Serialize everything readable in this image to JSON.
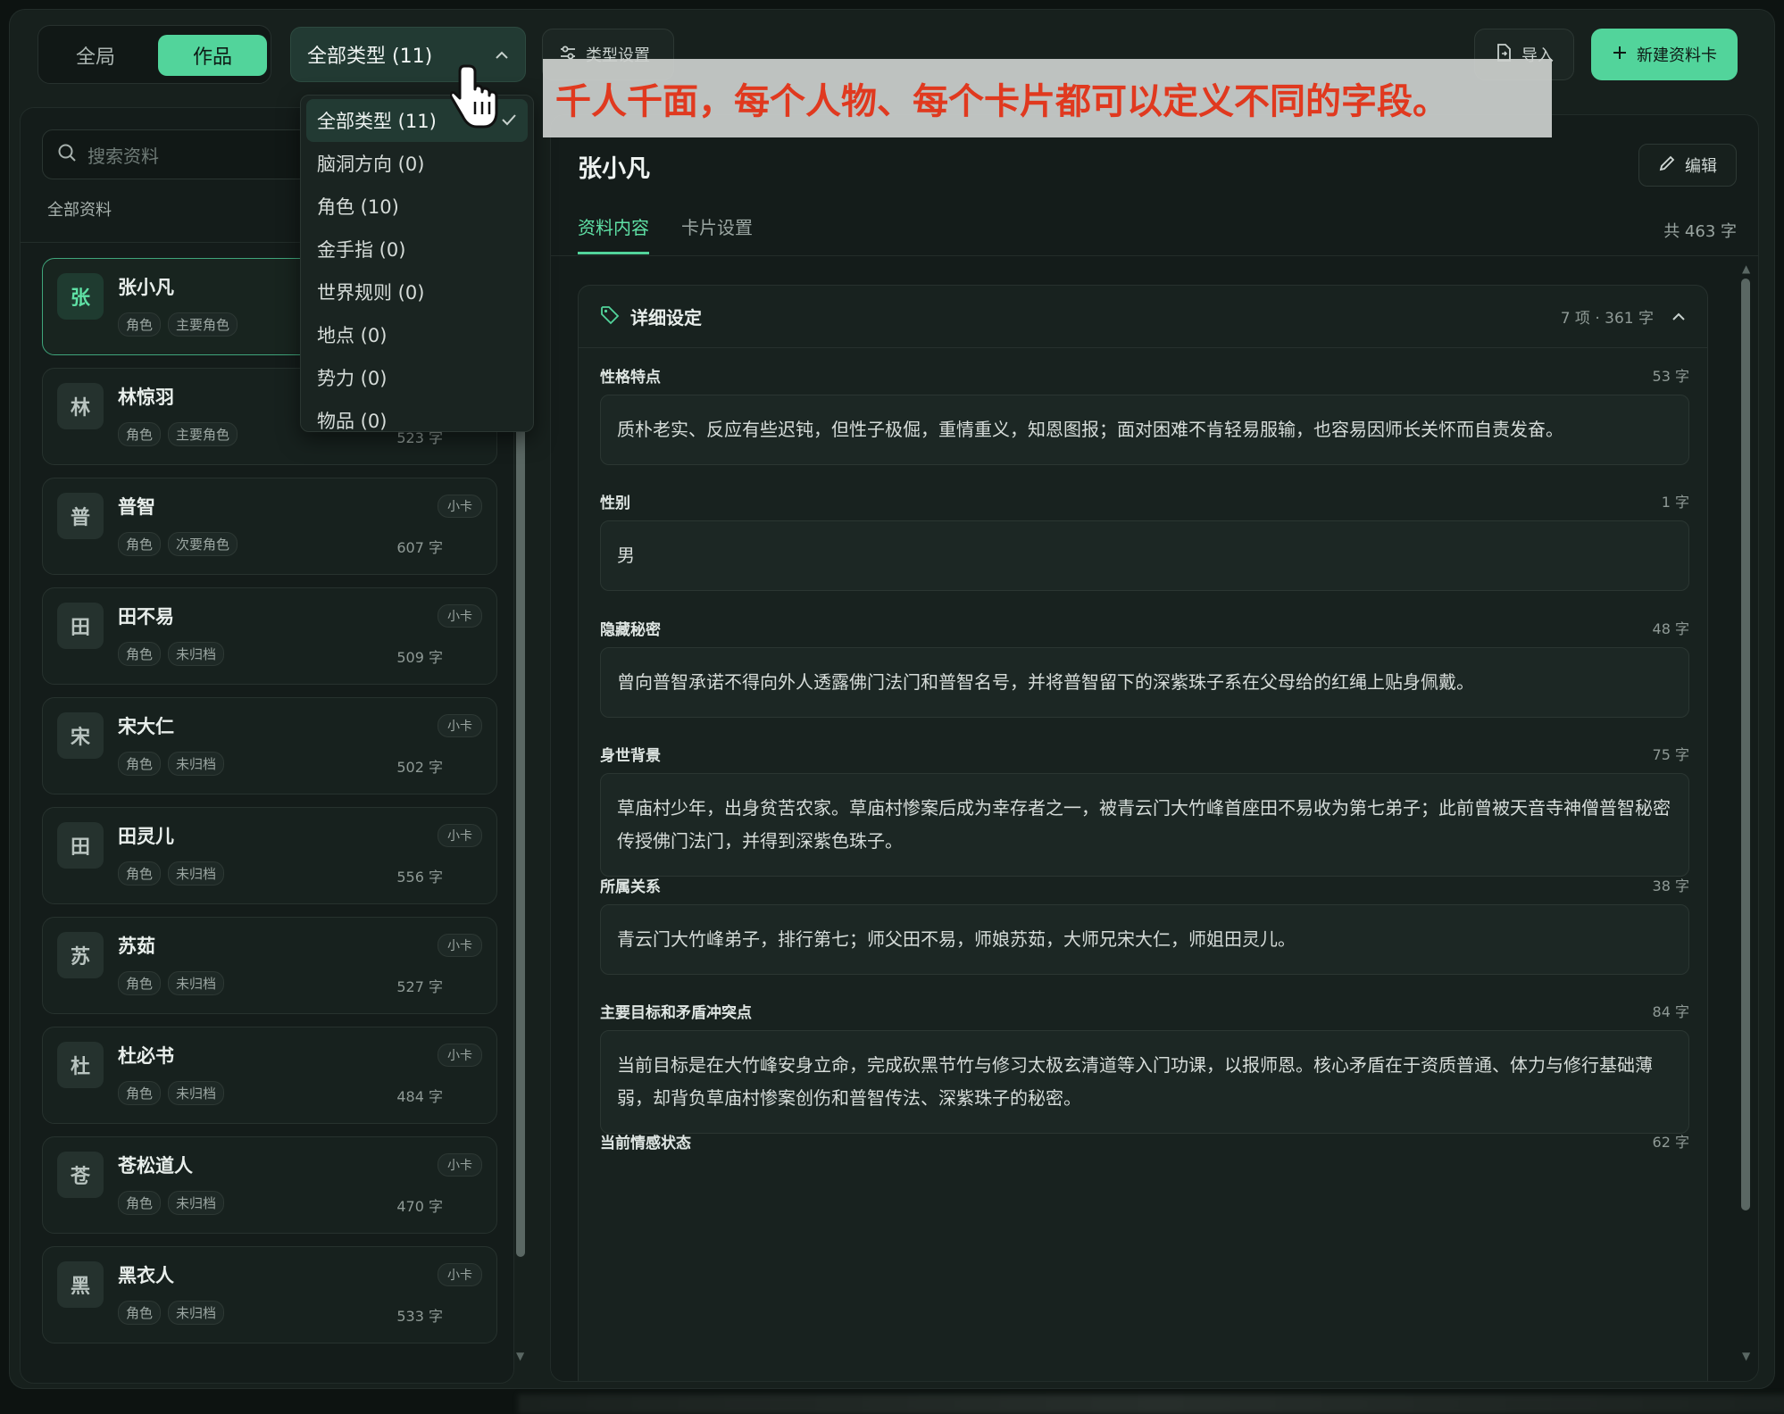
{
  "topbar": {
    "seg_global": "全局",
    "seg_works": "作品",
    "type_filter": "全部类型 (11)",
    "type_settings": "类型设置",
    "import": "导入",
    "new_card": "新建资料卡"
  },
  "dropdown": {
    "items": [
      {
        "label": "全部类型 (11)",
        "selected": true
      },
      {
        "label": "脑洞方向 (0)"
      },
      {
        "label": "角色 (10)"
      },
      {
        "label": "金手指 (0)"
      },
      {
        "label": "世界规则 (0)"
      },
      {
        "label": "地点 (0)"
      },
      {
        "label": "势力 (0)"
      },
      {
        "label": "物品 (0)"
      }
    ]
  },
  "annotation": "千人千面，每个人物、每个卡片都可以定义不同的字段。",
  "left": {
    "search_placeholder": "搜索资料",
    "all_label": "全部资料",
    "cards": [
      {
        "avatar": "张",
        "name": "张小凡",
        "tags": [
          "角色",
          "主要角色"
        ],
        "badge": "",
        "count": ""
      },
      {
        "avatar": "林",
        "name": "林惊羽",
        "tags": [
          "角色",
          "主要角色"
        ],
        "badge": "",
        "count": "523 字"
      },
      {
        "avatar": "普",
        "name": "普智",
        "tags": [
          "角色",
          "次要角色"
        ],
        "badge": "小卡",
        "count": "607 字"
      },
      {
        "avatar": "田",
        "name": "田不易",
        "tags": [
          "角色",
          "未归档"
        ],
        "badge": "小卡",
        "count": "509 字"
      },
      {
        "avatar": "宋",
        "name": "宋大仁",
        "tags": [
          "角色",
          "未归档"
        ],
        "badge": "小卡",
        "count": "502 字"
      },
      {
        "avatar": "田",
        "name": "田灵儿",
        "tags": [
          "角色",
          "未归档"
        ],
        "badge": "小卡",
        "count": "556 字"
      },
      {
        "avatar": "苏",
        "name": "苏茹",
        "tags": [
          "角色",
          "未归档"
        ],
        "badge": "小卡",
        "count": "527 字"
      },
      {
        "avatar": "杜",
        "name": "杜必书",
        "tags": [
          "角色",
          "未归档"
        ],
        "badge": "小卡",
        "count": "484 字"
      },
      {
        "avatar": "苍",
        "name": "苍松道人",
        "tags": [
          "角色",
          "未归档"
        ],
        "badge": "小卡",
        "count": "470 字"
      },
      {
        "avatar": "黑",
        "name": "黑衣人",
        "tags": [
          "角色",
          "未归档"
        ],
        "badge": "小卡",
        "count": "533 字"
      }
    ]
  },
  "detail": {
    "title": "张小凡",
    "edit": "编辑",
    "tabs": [
      "资料内容",
      "卡片设置"
    ],
    "total": "共 463 字",
    "section_title": "详细设定",
    "section_meta": "7 项 · 361 字",
    "fields": [
      {
        "label": "性格特点",
        "count": "53 字",
        "text": "质朴老实、反应有些迟钝，但性子极倔，重情重义，知恩图报；面对困难不肯轻易服输，也容易因师长关怀而自责发奋。"
      },
      {
        "label": "性别",
        "count": "1 字",
        "text": "男"
      },
      {
        "label": "隐藏秘密",
        "count": "48 字",
        "text": "曾向普智承诺不得向外人透露佛门法门和普智名号，并将普智留下的深紫珠子系在父母给的红绳上贴身佩戴。"
      },
      {
        "label": "身世背景",
        "count": "75 字",
        "text": "草庙村少年，出身贫苦农家。草庙村惨案后成为幸存者之一，被青云门大竹峰首座田不易收为第七弟子；此前曾被天音寺神僧普智秘密传授佛门法门，并得到深紫色珠子。"
      },
      {
        "label": "所属关系",
        "count": "38 字",
        "text": "青云门大竹峰弟子，排行第七；师父田不易，师娘苏茹，大师兄宋大仁，师姐田灵儿。"
      },
      {
        "label": "主要目标和矛盾冲突点",
        "count": "84 字",
        "text": "当前目标是在大竹峰安身立命，完成砍黑节竹与修习太极玄清道等入门功课，以报师恩。核心矛盾在于资质普通、体力与修行基础薄弱，却背负草庙村惨案创伤和普智传法、深紫珠子的秘密。"
      },
      {
        "label": "当前情感状态",
        "count": "62 字",
        "text": ""
      }
    ]
  },
  "colors": {
    "accent": "#52d49b",
    "annotation_text": "#e0391f"
  }
}
